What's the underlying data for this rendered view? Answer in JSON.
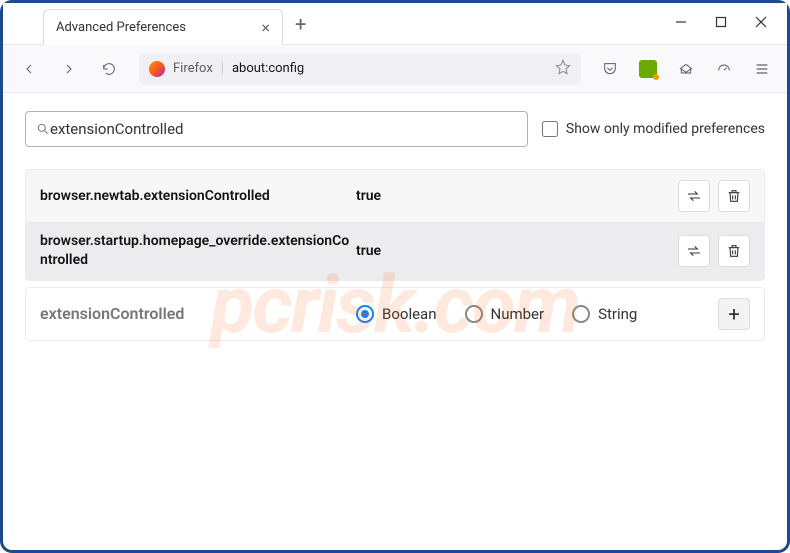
{
  "window": {
    "tab_title": "Advanced Preferences",
    "address_prefix": "Firefox",
    "address_path": "about:config"
  },
  "search": {
    "value": "extensionControlled",
    "modified_only_label": "Show only modified preferences"
  },
  "prefs": [
    {
      "name": "browser.newtab.extensionControlled",
      "value": "true"
    },
    {
      "name": "browser.startup.homepage_override.extensionControlled",
      "value": "true"
    }
  ],
  "new_pref": {
    "name": "extensionControlled",
    "types": [
      "Boolean",
      "Number",
      "String"
    ],
    "selected": "Boolean"
  },
  "watermark": "pcrisk.com"
}
